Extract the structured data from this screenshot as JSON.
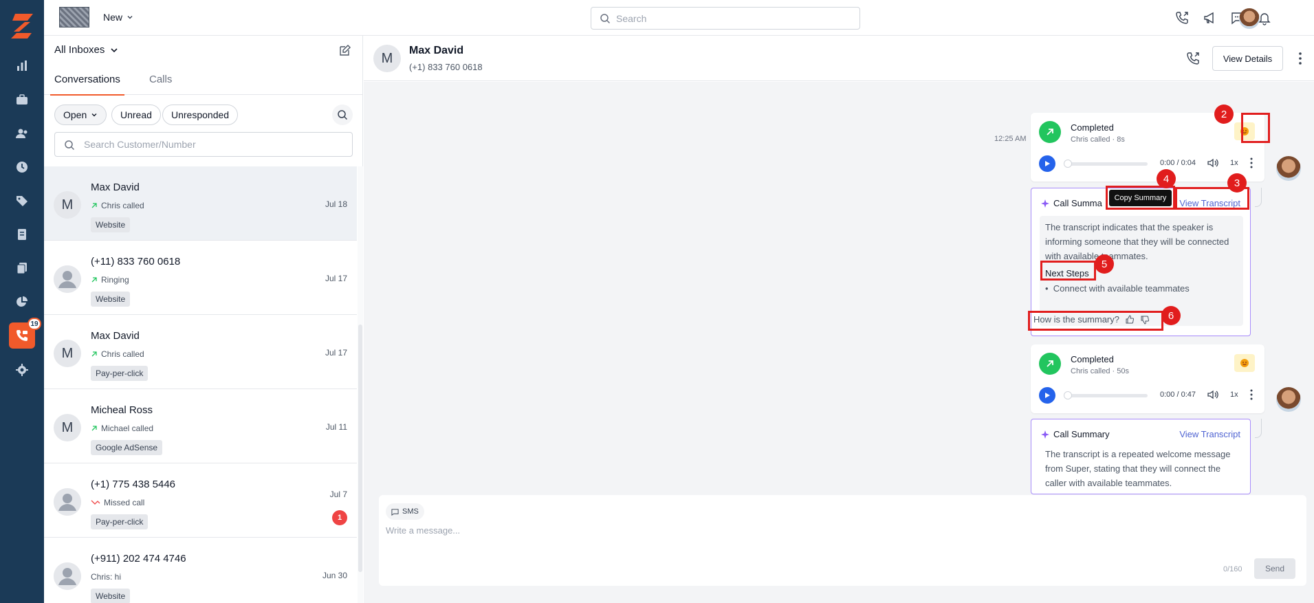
{
  "topbar": {
    "new_label": "New",
    "search_placeholder": "Search"
  },
  "rail": {
    "badge_count": "19",
    "accent": "#f15a2b",
    "background": "#1b3a57"
  },
  "left_panel": {
    "inbox_selector": "All Inboxes",
    "tabs": [
      {
        "label": "Conversations"
      },
      {
        "label": "Calls"
      }
    ],
    "filters": [
      {
        "label": "Open"
      },
      {
        "label": "Unread"
      },
      {
        "label": "Unresponded"
      }
    ],
    "customer_search_placeholder": "Search Customer/Number",
    "conversations": [
      {
        "avatar": "M",
        "name": "Max David",
        "sub": "Chris called",
        "tag": "Website",
        "date": "Jul 18"
      },
      {
        "avatar": "",
        "name": "(+11) 833 760 0618",
        "sub": "Ringing",
        "tag": "Website",
        "date": "Jul 17"
      },
      {
        "avatar": "M",
        "name": "Max David",
        "sub": "Chris called",
        "tag": "Pay-per-click",
        "date": "Jul 17"
      },
      {
        "avatar": "M",
        "name": "Micheal Ross",
        "sub": "Michael called",
        "tag": "Google AdSense",
        "date": "Jul 11"
      },
      {
        "avatar": "",
        "name": "(+1) 775 438 5446",
        "sub": "Missed call",
        "tag": "Pay-per-click",
        "date": "Jul 7",
        "unread": "1"
      },
      {
        "avatar": "",
        "name": "(+911) 202 474 4746",
        "sub": "Chris: hi",
        "tag": "Website",
        "date": "Jun 30"
      }
    ]
  },
  "chat_header": {
    "avatar": "M",
    "name": "Max David",
    "phone": "(+1) 833 760 0618",
    "view_details": "View Details"
  },
  "messages": {
    "timestamp": "12:25 AM",
    "calls": [
      {
        "status": "Completed",
        "sub": "Chris called · 8s",
        "time": "0:00 / 0:04",
        "speed": "1x"
      },
      {
        "status": "Completed",
        "sub": "Chris called · 50s",
        "time": "0:00 / 0:47",
        "speed": "1x"
      }
    ],
    "summaries": [
      {
        "title": "Call Summa",
        "view_transcript": "View Transcript",
        "text": "The transcript indicates that the speaker is informing someone that they will be connected with available teammates.",
        "next_steps": "Next Steps",
        "bullet": "Connect with available teammates"
      },
      {
        "title": "Call Summary",
        "view_transcript": "View Transcript",
        "text": "The transcript is a repeated welcome message from Super, stating that they will connect the caller with available teammates."
      }
    ],
    "tooltip": "Copy Summary",
    "feedback_prompt": "How is the summary?"
  },
  "annotations": [
    "2",
    "3",
    "4",
    "5",
    "6"
  ],
  "composer": {
    "channel": "SMS",
    "placeholder": "Write a message...",
    "counter": "0/160",
    "send": "Send"
  }
}
